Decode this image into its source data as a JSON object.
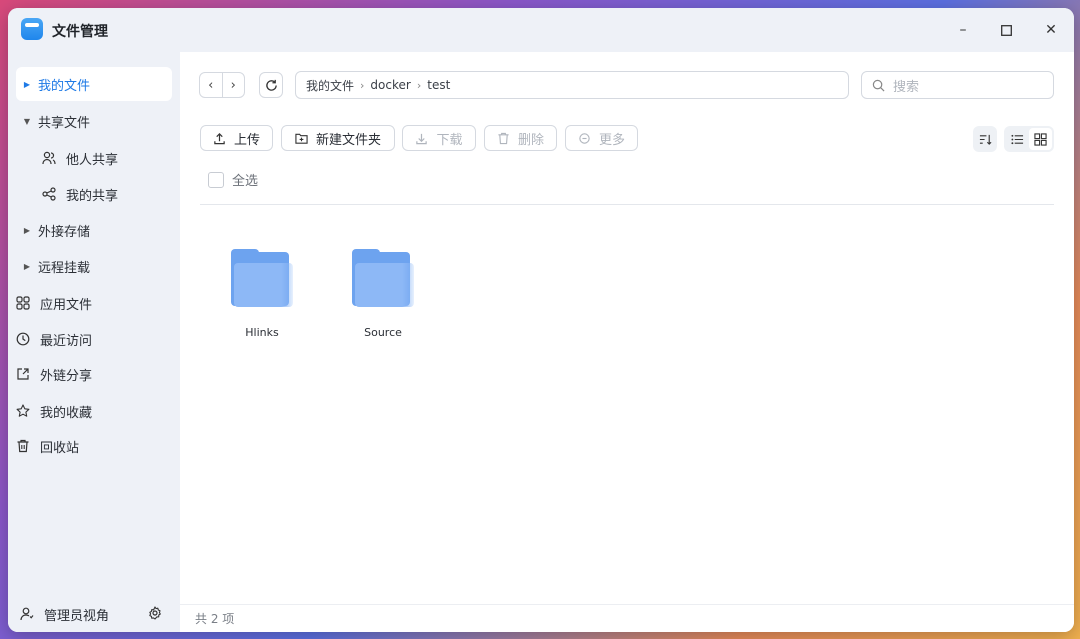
{
  "window": {
    "title": "文件管理",
    "controls": {
      "minimize": "–",
      "maximize": "☐",
      "close": "✕"
    }
  },
  "sidebar": {
    "items": [
      {
        "label": "我的文件",
        "icon": "caret-right-icon",
        "active": true
      },
      {
        "label": "共享文件",
        "icon": "caret-down-icon"
      },
      {
        "label": "他人共享",
        "icon": "users-icon"
      },
      {
        "label": "我的共享",
        "icon": "share-icon"
      },
      {
        "label": "外接存储",
        "icon": "caret-right-icon"
      },
      {
        "label": "远程挂载",
        "icon": "caret-right-icon"
      },
      {
        "label": "应用文件",
        "icon": "apps-icon"
      },
      {
        "label": "最近访问",
        "icon": "clock-icon"
      },
      {
        "label": "外链分享",
        "icon": "external-link-icon"
      },
      {
        "label": "我的收藏",
        "icon": "star-icon"
      },
      {
        "label": "回收站",
        "icon": "trash-icon"
      }
    ],
    "footer_label": "管理员视角"
  },
  "toolbar": {
    "path": [
      "我的文件",
      "docker",
      "test"
    ],
    "search_placeholder": "搜索",
    "upload": "上传",
    "new_folder": "新建文件夹",
    "download": "下载",
    "delete": "删除",
    "more": "更多"
  },
  "list": {
    "select_all": "全选",
    "folders": [
      {
        "name": "Hlinks"
      },
      {
        "name": "Source"
      }
    ]
  },
  "status": {
    "count_text": "共 2 项"
  },
  "colors": {
    "accent": "#1e7ae6",
    "folder": "#6da3ef"
  }
}
